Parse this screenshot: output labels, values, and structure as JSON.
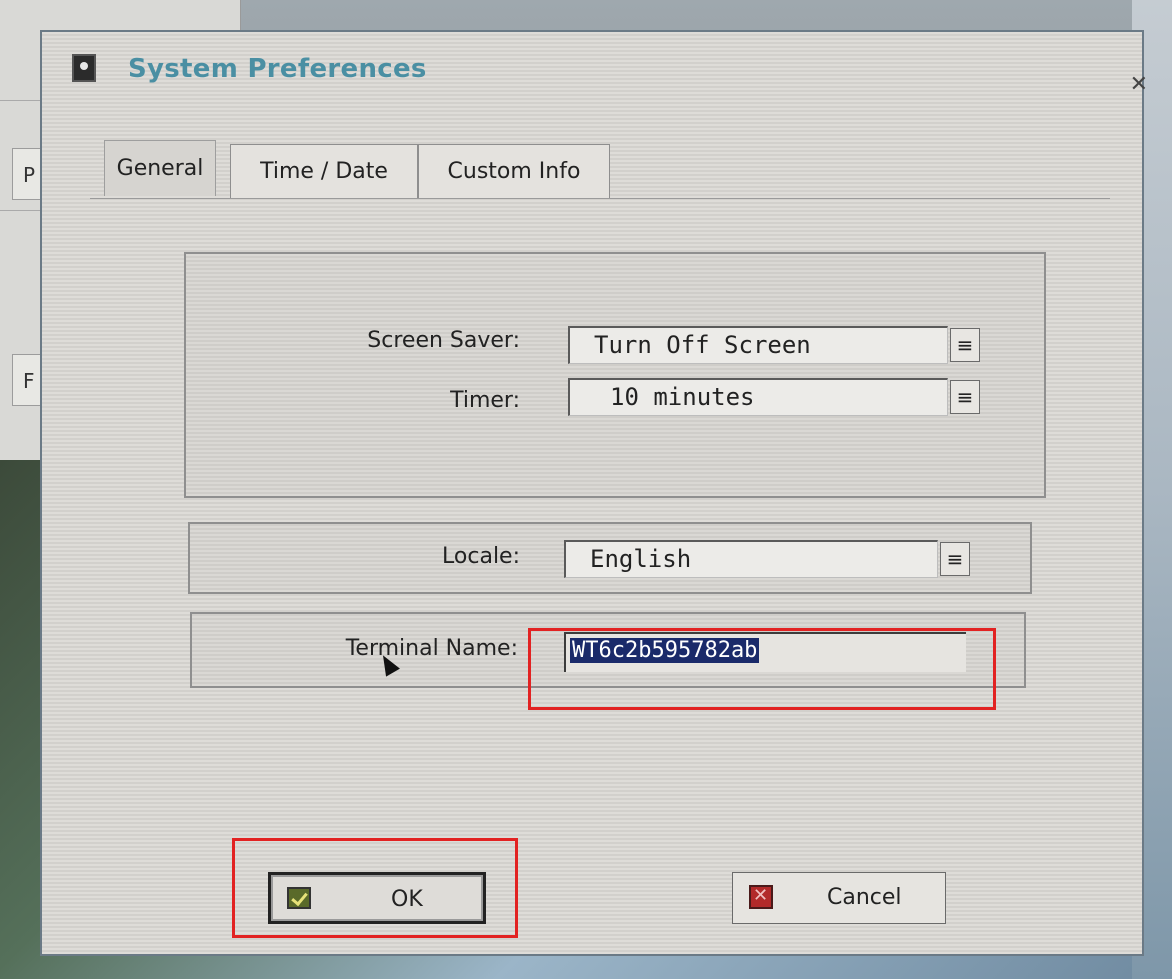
{
  "window": {
    "title": "System Preferences"
  },
  "background": {
    "left_button_1": "P",
    "left_button_2": "F"
  },
  "tabs": [
    {
      "label": "General",
      "active": true
    },
    {
      "label": "Time / Date",
      "active": false
    },
    {
      "label": "Custom Info",
      "active": false
    }
  ],
  "general": {
    "screen_saver": {
      "label": "Screen Saver:",
      "value": "Turn Off Screen"
    },
    "timer": {
      "label": "Timer:",
      "value": "10 minutes"
    },
    "locale": {
      "label": "Locale:",
      "value": "English"
    },
    "terminal_name": {
      "label": "Terminal Name:",
      "value": "WT6c2b595782ab"
    }
  },
  "buttons": {
    "ok": "OK",
    "cancel": "Cancel"
  },
  "dropdown_glyph": "≡",
  "colors": {
    "highlight": "#e22222",
    "title": "#4a8fa3",
    "selection": "#1a2a6a"
  }
}
